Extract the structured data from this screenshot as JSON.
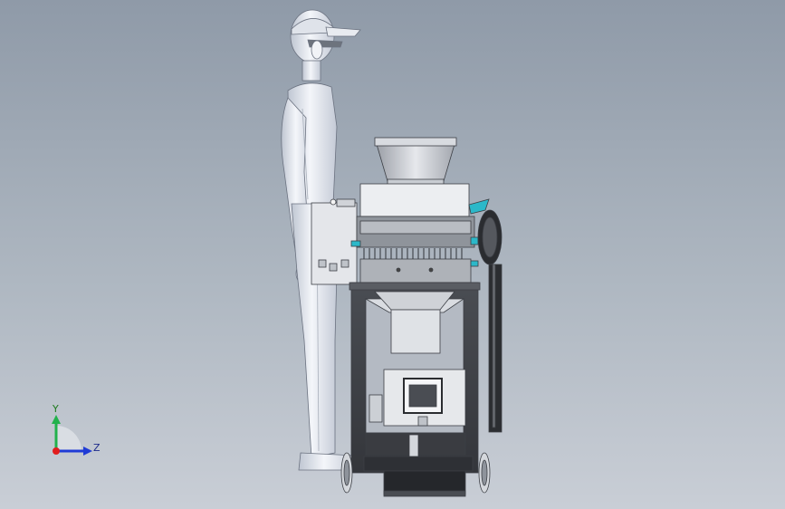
{
  "viewport": {
    "background_top": "#8f9aa8",
    "background_bottom": "#c9ced6"
  },
  "triad": {
    "y_label": "Y",
    "z_label": "Z",
    "colors": {
      "y": "#22b14c",
      "z": "#1f3bd6",
      "x": "#e11d1d"
    }
  },
  "model": {
    "figure": "mannequin-icon",
    "machine": "machine-assembly-icon"
  }
}
